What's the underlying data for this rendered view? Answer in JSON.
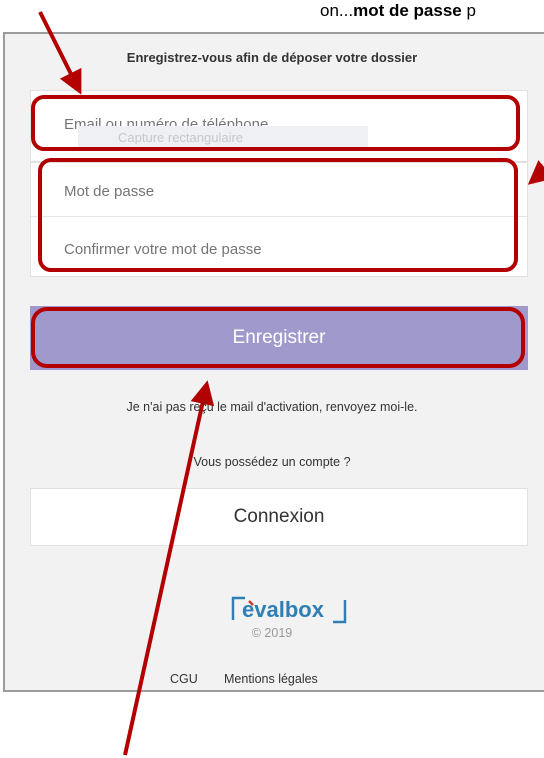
{
  "page": {
    "top_text_prefix": "on...",
    "top_text_bold": "mot de passe",
    "top_text_suffix": " p"
  },
  "form": {
    "title": "Enregistrez-vous afin de déposer votre dossier",
    "email_placeholder": "Email ou numéro de téléphone",
    "password_placeholder": "Mot de passe",
    "confirm_placeholder": "Confirmer votre mot de passe",
    "ghost_text": "Capture rectangulaire",
    "register_label": "Enregistrer",
    "resend_text": "Je n'ai pas reçu le mail d'activation, renvoyez moi-le.",
    "have_account_text": "Vous possédez un compte ?",
    "connexion_label": "Connexion"
  },
  "footer": {
    "logo_text": "evalbox",
    "copyright": "© 2019",
    "cgu": "CGU",
    "mentions": "Mentions légales"
  },
  "colors": {
    "annotation": "#b30000",
    "button": "#a099cc",
    "panel": "#f2f2f2",
    "logo_blue": "#2f7fb5",
    "logo_red": "#d13a2f"
  }
}
